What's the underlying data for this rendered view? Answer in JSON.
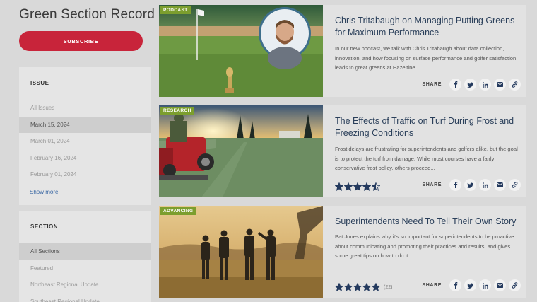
{
  "site": {
    "title": "Green Section Record",
    "subscribe_label": "SUBSCRIBE"
  },
  "issue_panel": {
    "heading": "ISSUE",
    "items": [
      "All Issues",
      "March 15, 2024",
      "March 01, 2024",
      "February 16, 2024",
      "February 01, 2024"
    ],
    "active_index": 1,
    "show_more": "Show more"
  },
  "section_panel": {
    "heading": "SECTION",
    "items": [
      "All Sections",
      "Featured",
      "Northeast Regional Update",
      "Southeast Regional Update"
    ],
    "active_index": 0
  },
  "share_label": "SHARE",
  "share_icons": [
    "facebook-icon",
    "twitter-icon",
    "linkedin-icon",
    "email-icon",
    "link-icon"
  ],
  "articles": [
    {
      "tag": "PODCAST",
      "title": "Chris Tritabaugh on Managing Putting Greens for Maximum Performance",
      "description": "In our new podcast, we talk with Chris Tritabaugh about data collection, innovation, and how focusing on surface performance and golfer satisfaction leads to great greens at Hazeltine.",
      "rating": null,
      "rating_count": ""
    },
    {
      "tag": "RESEARCH",
      "title": "The Effects of Traffic on Turf During Frost and Freezing Conditions",
      "description": "Frost delays are frustrating for superintendents and golfers alike, but the goal is to protect the turf from damage. While most courses have a fairly conservative frost policy, others proceed...",
      "rating": 4.5,
      "rating_count": ""
    },
    {
      "tag": "ADVANCING",
      "title": "Superintendents Need To Tell Their Own Story",
      "description": "Pat Jones explains why it's so important for superintendents to be proactive about communicating and promoting their practices and results, and gives some great tips on how to do it.",
      "rating": 5,
      "rating_count": "(22)"
    }
  ],
  "colors": {
    "accent": "#c8243a",
    "tag": "#7c9e2e",
    "title": "#2a3f5a",
    "star": "#243a5e",
    "link": "#3d6aa5"
  }
}
